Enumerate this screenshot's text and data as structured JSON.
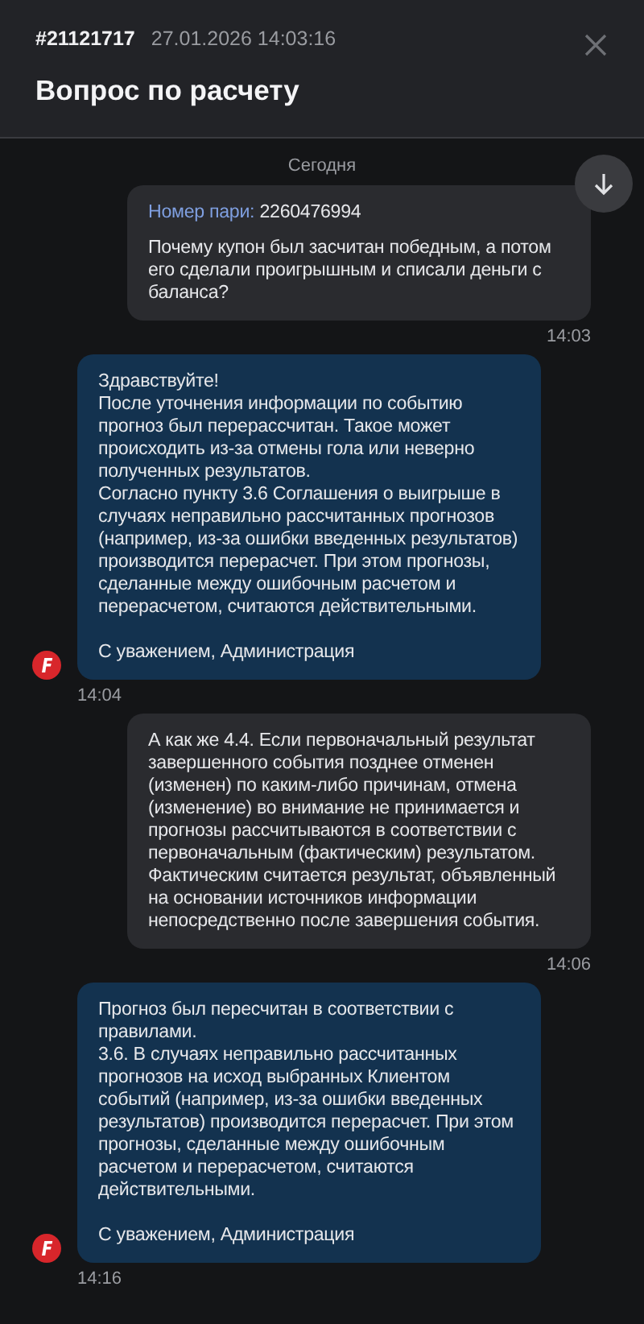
{
  "header": {
    "ticket_id": "#21121717",
    "datetime": "27.01.2026 14:03:16",
    "title": "Вопрос по расчету"
  },
  "date_divider": "Сегодня",
  "messages": [
    {
      "kind": "user",
      "bet_label": "Номер пари:",
      "bet_number": "2260476994",
      "text": "Почему купон был засчитан победным, а потом его сделали проигрышным и списали деньги с баланса?",
      "time": "14:03"
    },
    {
      "kind": "admin",
      "text": "Здравствуйте!\nПосле уточнения информации по событию прогноз был перерассчитан. Такое может происходить из-за отмены гола или неверно полученных результатов.\nСогласно пункту 3.6 Соглашения о выигрыше в случаях неправильно рассчитанных прогнозов (например, из-за ошибки введенных результатов) производится перерасчет. При этом прогнозы, сделанные между ошибочным расчетом и перерасчетом, считаются действительными.\n\nС уважением, Администрация",
      "time": "14:04"
    },
    {
      "kind": "user",
      "text": "А как же 4.4. Если первоначальный результат завершенного события позднее отменен (изменен) по каким-либо причинам, отмена (изменение) во внимание не принимается и прогнозы рассчитываются в соответствии с первоначальным (фактическим) результатом. Фактическим считается результат, объявленный на основании источников информации непосредственно после завершения события.",
      "time": "14:06"
    },
    {
      "kind": "admin",
      "text": "Прогноз был пересчитан в соответствии с правилами.\n3.6. В случаях неправильно рассчитанных прогнозов на исход выбранных Клиентом событий (например, из-за ошибки введенных результатов) производится перерасчет. При этом прогнозы, сделанные между ошибочным расчетом и перерасчетом, считаются действительными.\n\nС уважением, Администрация",
      "time": "14:16"
    }
  ]
}
